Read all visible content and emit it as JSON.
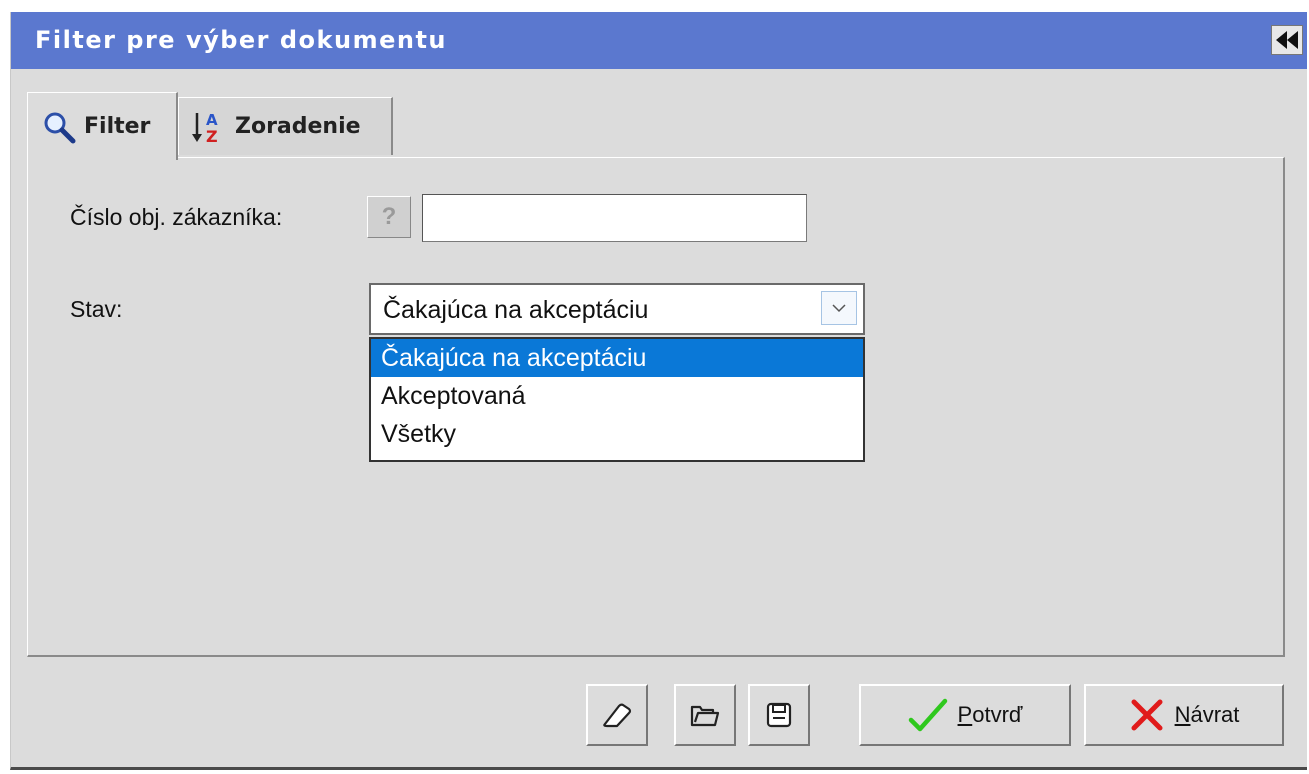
{
  "window": {
    "title": "Filter pre výber dokumentu"
  },
  "tabs": [
    {
      "label": "Filter",
      "icon": "magnifier-icon",
      "active": true
    },
    {
      "label": "Zoradenie",
      "icon": "sort-az-icon",
      "active": false
    }
  ],
  "filter": {
    "customer_order_label": "Číslo obj. zákazníka:",
    "customer_order_help": "?",
    "customer_order_value": "",
    "status_label": "Stav:",
    "status_value": "Čakajúca na akceptáciu",
    "status_options": [
      "Čakajúca na akceptáciu",
      "Akceptovaná",
      "Všetky"
    ],
    "status_selected_index": 0
  },
  "buttons": {
    "clear_icon": "eraser-icon",
    "open_icon": "open-folder-icon",
    "save_icon": "floppy-disk-icon",
    "confirm_first": "P",
    "confirm_rest": "otvrď",
    "back_first": "N",
    "back_rest": "ávrat"
  },
  "colors": {
    "titlebar": "#5b78cf",
    "selection": "#0a78d7",
    "confirm_check": "#2fc81e",
    "back_cross": "#e01b1b"
  }
}
